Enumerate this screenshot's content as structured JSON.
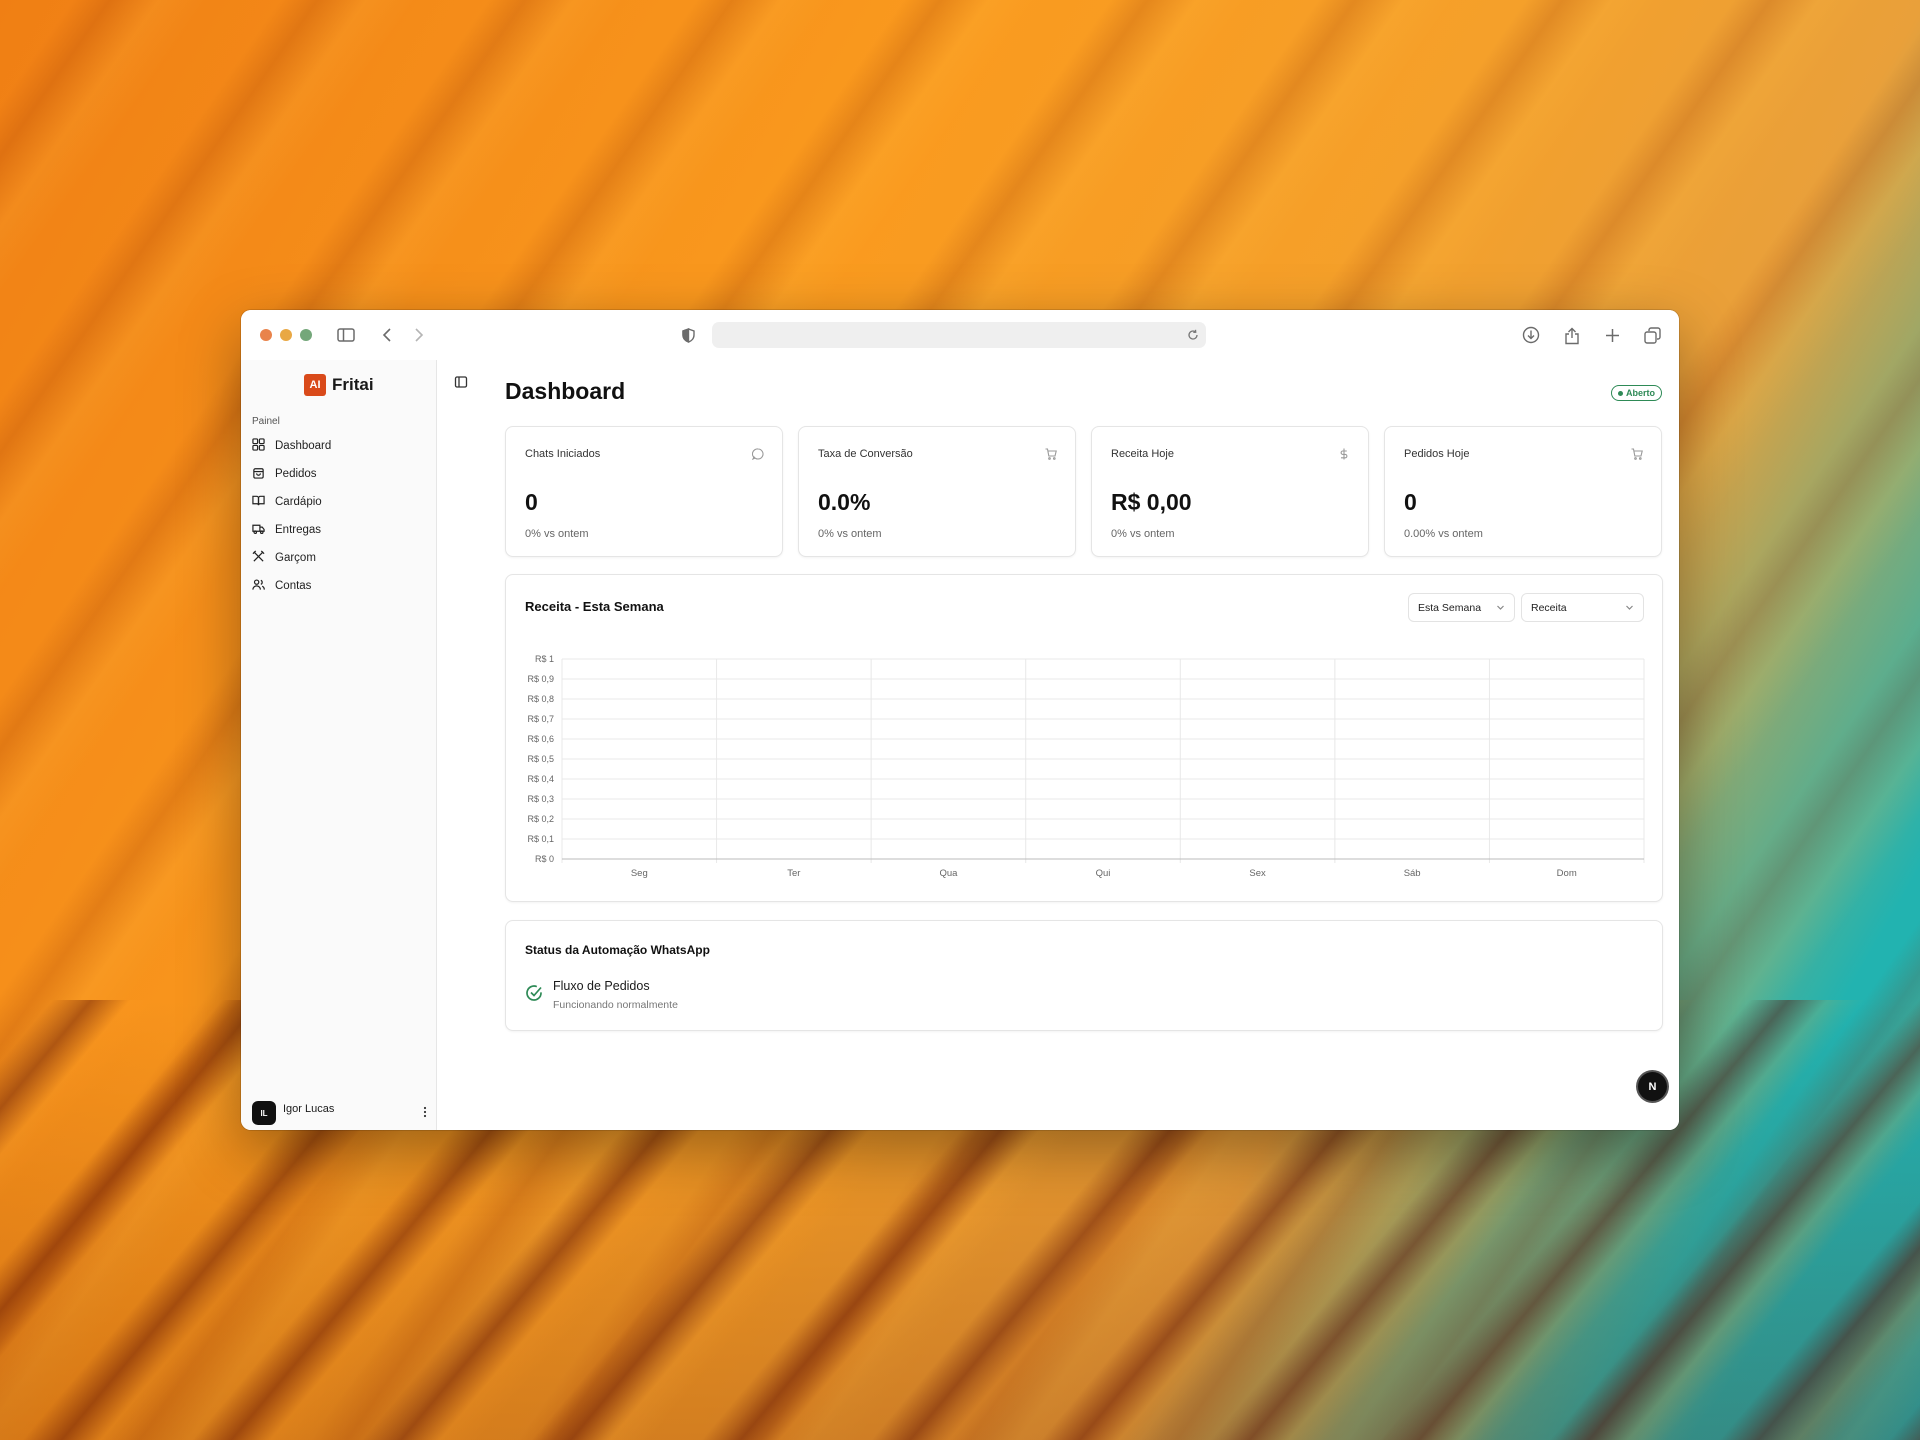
{
  "brand": {
    "logo_text": "AI",
    "name": "Fritai",
    "accent": "#d94a1a"
  },
  "sidebar": {
    "section_label": "Painel",
    "items": [
      {
        "label": "Dashboard",
        "icon": "grid-icon"
      },
      {
        "label": "Pedidos",
        "icon": "shopping-bag-icon"
      },
      {
        "label": "Cardápio",
        "icon": "book-open-icon"
      },
      {
        "label": "Entregas",
        "icon": "truck-icon"
      },
      {
        "label": "Garçom",
        "icon": "utensils-icon"
      },
      {
        "label": "Contas",
        "icon": "users-icon"
      }
    ],
    "user": {
      "initials": "IL",
      "name": "Igor Lucas"
    }
  },
  "header": {
    "title": "Dashboard",
    "status": {
      "label": "Aberto",
      "color": "#2e8a56"
    }
  },
  "kpis": [
    {
      "title": "Chats Iniciados",
      "value": "0",
      "delta": "0% vs ontem",
      "icon": "message-circle-icon"
    },
    {
      "title": "Taxa de Conversão",
      "value": "0.0%",
      "delta": "0% vs ontem",
      "icon": "cart-icon"
    },
    {
      "title": "Receita Hoje",
      "value": "R$ 0,00",
      "delta": "0% vs ontem",
      "icon": "dollar-icon"
    },
    {
      "title": "Pedidos Hoje",
      "value": "0",
      "delta": "0.00% vs ontem",
      "icon": "cart-icon"
    }
  ],
  "chart": {
    "title": "Receita - Esta Semana",
    "period_select": "Esta Semana",
    "metric_select": "Receita"
  },
  "chart_data": {
    "type": "line",
    "title": "Receita - Esta Semana",
    "categories": [
      "Seg",
      "Ter",
      "Qua",
      "Qui",
      "Sex",
      "Sáb",
      "Dom"
    ],
    "series": [
      {
        "values": [
          0,
          0,
          0,
          0,
          0,
          0,
          0
        ]
      }
    ],
    "y_ticks": [
      "R$ 0",
      "R$ 0,1",
      "R$ 0,2",
      "R$ 0,3",
      "R$ 0,4",
      "R$ 0,5",
      "R$ 0,6",
      "R$ 0,7",
      "R$ 0,8",
      "R$ 0,9",
      "R$ 1"
    ],
    "ylim": [
      0,
      1
    ],
    "grid": true
  },
  "whatsapp": {
    "title": "Status da Automação WhatsApp",
    "flow_name": "Fluxo de Pedidos",
    "flow_status": "Funcionando normalmente",
    "status_color": "#2e8a56"
  },
  "floating_badge": {
    "label": "N"
  }
}
